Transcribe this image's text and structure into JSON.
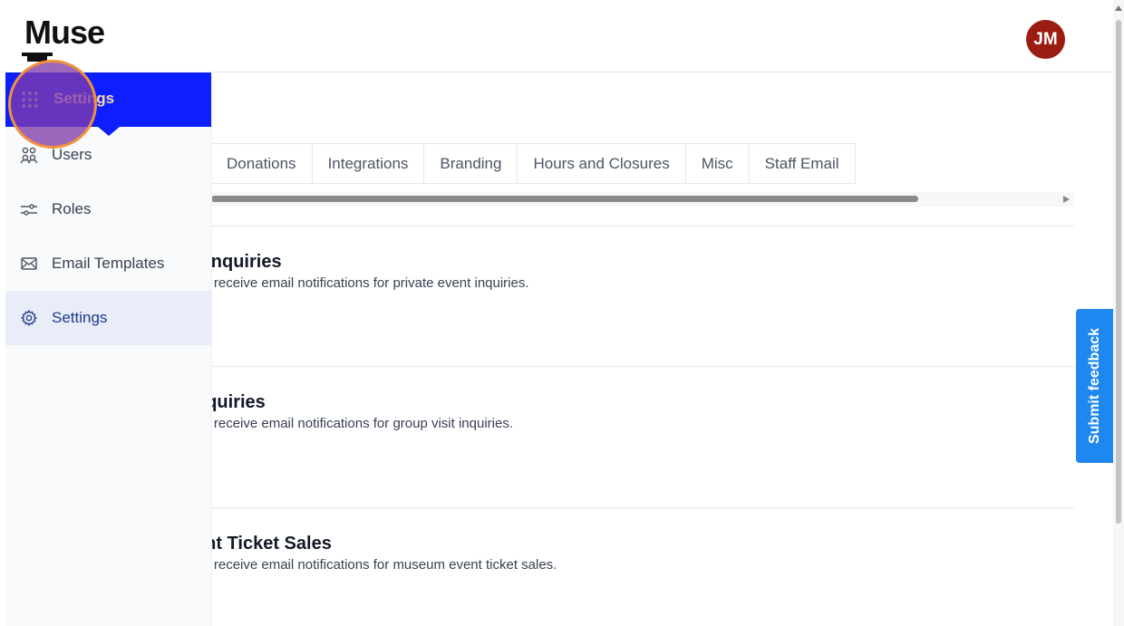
{
  "header": {
    "logo": "Muse",
    "avatar_initials": "JM"
  },
  "sidebar": {
    "menu_label": "Settings",
    "items": [
      {
        "label": "Users",
        "icon": "users-icon"
      },
      {
        "label": "Roles",
        "icon": "sliders-icon"
      },
      {
        "label": "Email Templates",
        "icon": "envelope-icon"
      },
      {
        "label": "Settings",
        "icon": "gear-icon",
        "active": true
      }
    ]
  },
  "tabs": [
    "Donations",
    "Integrations",
    "Branding",
    "Hours and Closures",
    "Misc",
    "Staff Email"
  ],
  "sections": [
    {
      "title": "t Inquiries",
      "desc": "ho receive email notifications for private event inquiries."
    },
    {
      "title": "nquiries",
      "desc": "ho receive email notifications for group visit inquiries."
    },
    {
      "title": "ent Ticket Sales",
      "desc": "ho receive email notifications for museum event ticket sales."
    }
  ],
  "feedback_label": "Submit feedback",
  "colors": {
    "accent": "#0d1fff",
    "avatar": "#9b1c10",
    "feedback": "#1e88f0",
    "highlight": "#f0923c"
  }
}
